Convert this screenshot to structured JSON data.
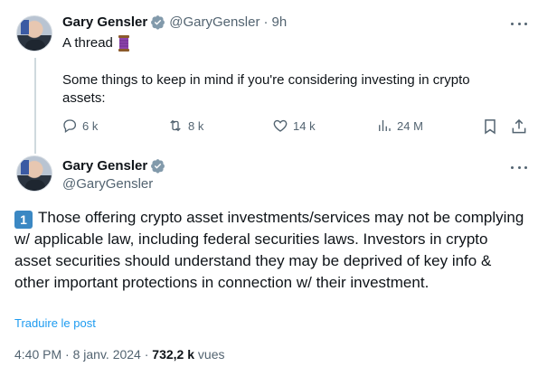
{
  "tweet1": {
    "name": "Gary Gensler",
    "handle": "@GaryGensler",
    "separator": "·",
    "time": "9h",
    "line1": "A thread",
    "line2": "Some things to keep in mind if you're considering investing in crypto assets:",
    "actions": {
      "replies": "6 k",
      "retweets": "8 k",
      "likes": "14 k",
      "views": "24 M"
    }
  },
  "tweet2": {
    "name": "Gary Gensler",
    "handle": "@GaryGensler",
    "number_emoji": "1",
    "body": "Those offering crypto asset investments/services may not be complying w/ applicable law, including federal securities laws. Investors in crypto asset securities should understand they may be deprived of key info & other important protections in connection w/ their investment.",
    "translate": "Traduire le post",
    "timestamp": "4:40 PM",
    "date": "8 janv. 2024",
    "views_count": "732,2 k",
    "views_label": "vues",
    "dot": "·"
  },
  "colors": {
    "accent": "#1d9bf0",
    "muted": "#536471",
    "text": "#0f1419",
    "thread_line": "#cfd9de"
  },
  "icons": [
    "thread-spool-icon",
    "verified-icon",
    "more-icon",
    "reply-icon",
    "retweet-icon",
    "like-icon",
    "views-icon",
    "bookmark-icon",
    "share-icon"
  ]
}
